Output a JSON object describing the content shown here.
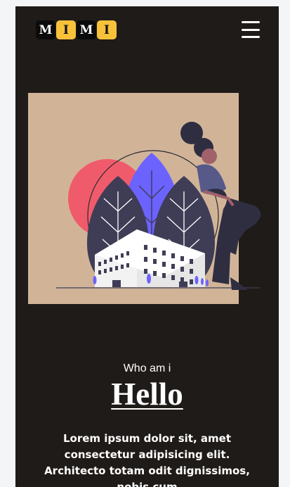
{
  "logo": {
    "letters": [
      "M",
      "I",
      "M",
      "I"
    ]
  },
  "nav": {
    "menu_icon": "hamburger-menu-icon"
  },
  "hero": {
    "illustration": "woman-leaning-on-building-illustration",
    "eyebrow": "Who am i",
    "heading": "Hello",
    "paragraph": "Lorem ipsum dolor sit, amet consectetur adipisicing elit. Architecto totam odit dignissimos, nobis cum"
  },
  "colors": {
    "page_background": "#f4f5f6",
    "frame_background": "#1f1b18",
    "logo_dark": "#0b0b0b",
    "logo_accent": "#f7c23a",
    "illustration_background": "#d1b498",
    "illustration_accent": "#6c63ff"
  }
}
